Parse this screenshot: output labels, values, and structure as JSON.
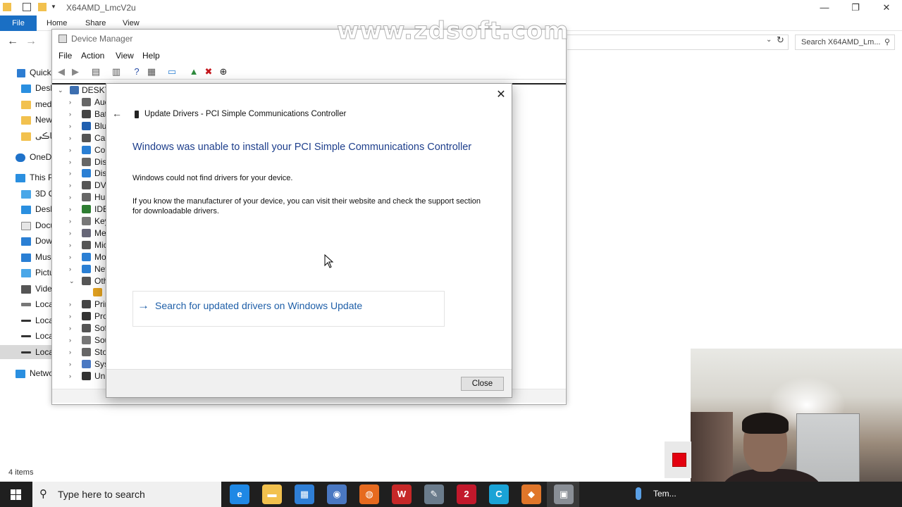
{
  "explorer": {
    "title": "X64AMD_LmcV2u",
    "ribbon_tabs": [
      "File",
      "Home",
      "Share",
      "View"
    ],
    "search_placeholder": "Search X64AMD_Lm...",
    "nav_items": [
      "Quick",
      "Desk",
      "med",
      "New",
      "ڪاڪی",
      "OneDr",
      "This Pc",
      "3D O",
      "Desk",
      "Docu",
      "Dow",
      "Musi",
      "Pictu",
      "Video",
      "Loca",
      "Loca",
      "Loca",
      "Loca",
      "Netwo"
    ],
    "status_items": "4 items",
    "window_controls": {
      "minimize": "—",
      "restore": "❐",
      "close": "✕"
    }
  },
  "device_manager": {
    "title": "Device Manager",
    "menu": [
      "File",
      "Action",
      "View",
      "Help"
    ],
    "root": "DESKTO",
    "tree": [
      "Aud",
      "Bat",
      "Blu",
      "Car",
      "Cor",
      "Disl",
      "Disp",
      "DVD",
      "Hur",
      "IDE",
      "Key",
      "Me",
      "Mic",
      "Mo",
      "Net",
      "Oth",
      "",
      "Prir",
      "Pro",
      "Sof",
      "Sou",
      "Sto",
      "Sys",
      "Uni"
    ],
    "expanded_index": 15
  },
  "dialog": {
    "caption": "Update Drivers - PCI Simple Communications Controller",
    "heading": "Windows was unable to install your PCI Simple Communications Controller",
    "message1": "Windows could not find drivers for your device.",
    "message2": "If you know the manufacturer of your device, you can visit their website and check the support section for downloadable drivers.",
    "option_label": "Search for updated drivers on Windows Update",
    "close_button": "Close",
    "close_x": "✕",
    "back_arrow": "←"
  },
  "watermark": "www.zdsoft.com",
  "taskbar": {
    "search_placeholder": "Type here to search",
    "temp_label": "Tem...",
    "apps": [
      {
        "name": "edge",
        "glyph": "e",
        "color": "#1e88e5"
      },
      {
        "name": "file-explorer",
        "glyph": "▬",
        "color": "#f2c14e"
      },
      {
        "name": "store",
        "glyph": "▦",
        "color": "#2f7fd6"
      },
      {
        "name": "device-app",
        "glyph": "◉",
        "color": "#4a78c2"
      },
      {
        "name": "firefox",
        "glyph": "◍",
        "color": "#e66a1f"
      },
      {
        "name": "app-2023",
        "glyph": "W",
        "color": "#c62828"
      },
      {
        "name": "paint-app",
        "glyph": "✎",
        "color": "#6b7c8c"
      },
      {
        "name": "zwcad",
        "glyph": "2",
        "color": "#c2182b"
      },
      {
        "name": "ccleaner",
        "glyph": "C",
        "color": "#1aa3d6"
      },
      {
        "name": "fox-app",
        "glyph": "◆",
        "color": "#e0762a"
      },
      {
        "name": "device-manager-app",
        "glyph": "▣",
        "color": "#8a8f96"
      }
    ]
  }
}
